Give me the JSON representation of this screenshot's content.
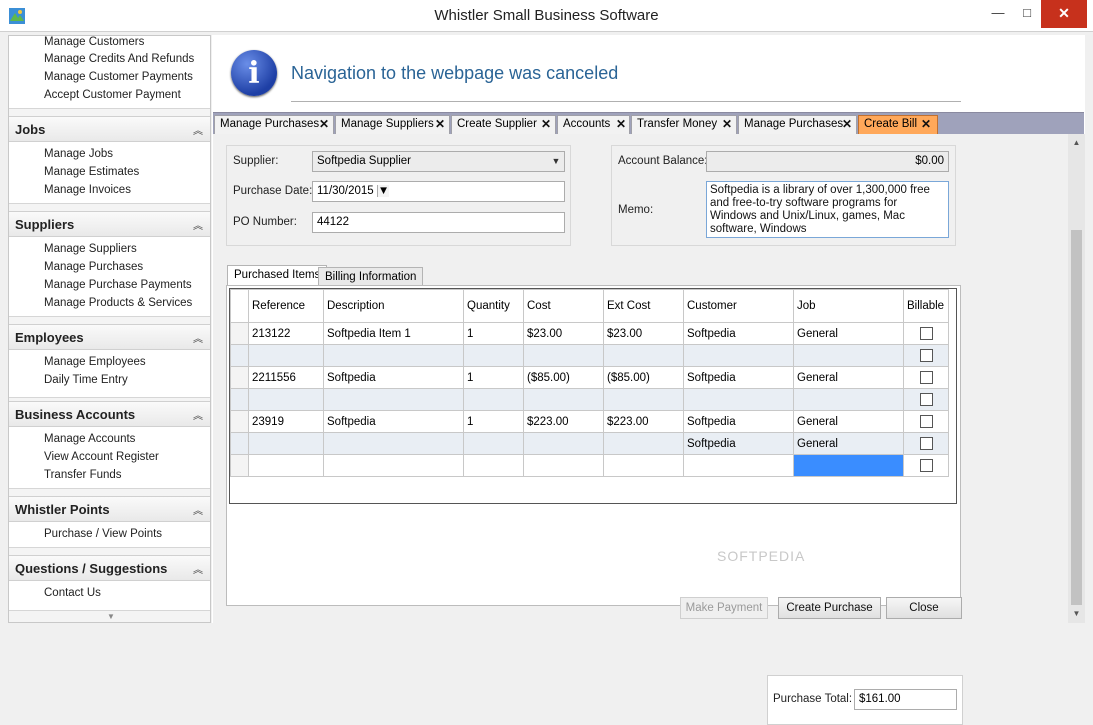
{
  "window": {
    "title": "Whistler Small  Business Software",
    "minimize": "—",
    "maximize": "□",
    "close": "✕"
  },
  "sidebar": {
    "top_links": [
      "Manage Customers",
      "Manage Credits And Refunds",
      "Manage Customer Payments",
      "Accept Customer Payment"
    ],
    "sections": [
      {
        "header": "Jobs",
        "links": [
          "Manage Jobs",
          "Manage Estimates",
          "Manage Invoices"
        ]
      },
      {
        "header": "Suppliers",
        "links": [
          "Manage Suppliers",
          "Manage Purchases",
          "Manage Purchase Payments",
          "Manage Products & Services"
        ]
      },
      {
        "header": "Employees",
        "links": [
          "Manage Employees",
          "Daily Time Entry"
        ]
      },
      {
        "header": "Business Accounts",
        "links": [
          "Manage Accounts",
          "View Account Register",
          "Transfer Funds"
        ]
      },
      {
        "header": "Whistler Points",
        "links": [
          "Purchase / View Points"
        ]
      },
      {
        "header": "Questions / Suggestions",
        "links": [
          "Contact Us"
        ]
      }
    ]
  },
  "navigation": {
    "message": "Navigation to the webpage was canceled",
    "icon": "info-icon"
  },
  "tabs": [
    "Manage Purchases",
    "Manage Suppliers",
    "Create Supplier",
    "Accounts",
    "Transfer Money",
    "Manage Purchases",
    "Create Bill"
  ],
  "active_tab": "Create Bill",
  "form": {
    "supplier_label": "Supplier:",
    "supplier_value": "Softpedia Supplier",
    "purchase_date_label": "Purchase Date:",
    "purchase_date_value": "11/30/2015",
    "po_number_label": "PO Number:",
    "po_number_value": "44122",
    "account_balance_label": "Account Balance:",
    "account_balance_value": "$0.00",
    "memo_label": "Memo:",
    "memo_value": "Softpedia is a library of over 1,300,000 free and free-to-try software programs for Windows and Unix/Linux, games, Mac software, Windows"
  },
  "subtabs": [
    "Purchased Items",
    "Billing Information"
  ],
  "grid": {
    "columns": [
      "Reference",
      "Description",
      "Quantity",
      "Cost",
      "Ext Cost",
      "Customer",
      "Job",
      "Billable"
    ],
    "rows": [
      [
        "213122",
        "Softpedia Item 1",
        "1",
        "$23.00",
        "$23.00",
        "Softpedia",
        "General",
        ""
      ],
      [
        "",
        "",
        "",
        "",
        "",
        "",
        "",
        ""
      ],
      [
        "2211556",
        "Softpedia",
        "1",
        "($85.00)",
        "($85.00)",
        "Softpedia",
        "General",
        ""
      ],
      [
        "",
        "",
        "",
        "",
        "",
        "",
        "",
        ""
      ],
      [
        "23919",
        "Softpedia",
        "1",
        "$223.00",
        "$223.00",
        "Softpedia",
        "General",
        ""
      ],
      [
        "",
        "",
        "",
        "",
        "",
        "Softpedia",
        "General",
        ""
      ],
      [
        "",
        "",
        "",
        "",
        "",
        "",
        "",
        ""
      ]
    ]
  },
  "totals": {
    "label": "Purchase Total:",
    "value": "$161.00"
  },
  "buttons": {
    "make_payment": "Make Payment",
    "create_purchase": "Create Purchase",
    "close": "Close"
  },
  "watermark": "SOFTPEDIA",
  "colors": {
    "active_tab": "#ffa85a",
    "nav_message": "#2a6496",
    "selected_cell": "#3a8dff",
    "close_button": "#c7311c"
  }
}
